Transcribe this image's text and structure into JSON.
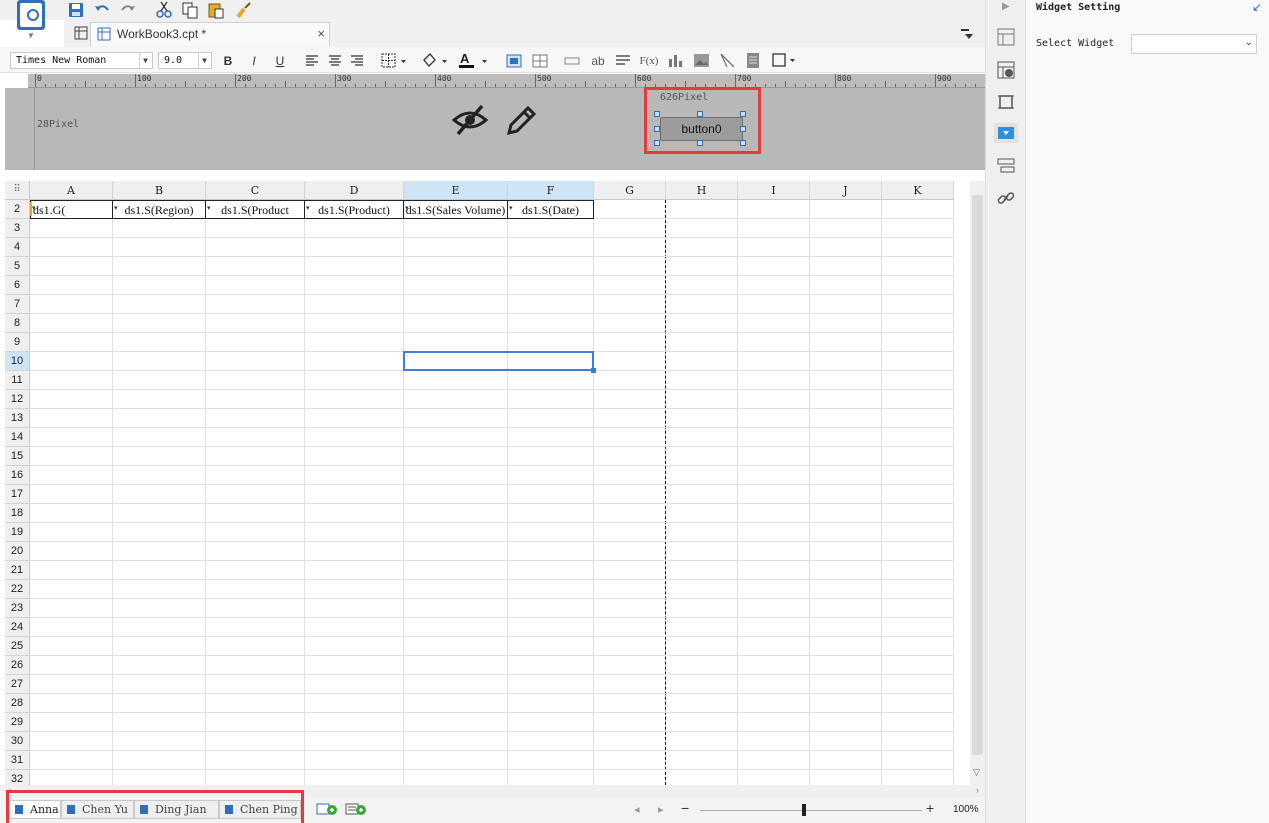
{
  "app": {
    "toolbar_dropdown_arrow": "▾"
  },
  "tab": {
    "label": "WorkBook3.cpt *",
    "close": "×"
  },
  "format_bar": {
    "font_name": "Times New Roman",
    "font_size": "9.0",
    "bold": "B",
    "italic": "I",
    "underline": "U",
    "text_sample": "ab",
    "formula": "F(x)"
  },
  "ruler": {
    "labels": [
      "0",
      "100",
      "200",
      "300",
      "400",
      "500",
      "600",
      "700",
      "800",
      "900"
    ]
  },
  "form": {
    "left_label": "28Pixel",
    "top_label": "626Pixel",
    "button_label": "button0"
  },
  "grid": {
    "columns": [
      "A",
      "B",
      "C",
      "D",
      "E",
      "F",
      "G",
      "H",
      "I",
      "J",
      "K"
    ],
    "highlighted_columns": [
      "E",
      "F"
    ],
    "rows": [
      "2",
      "3",
      "4",
      "5",
      "6",
      "7",
      "8",
      "9",
      "10",
      "11",
      "12",
      "13",
      "14",
      "15",
      "16",
      "17",
      "18",
      "19",
      "20",
      "21",
      "22",
      "23",
      "24",
      "25",
      "26",
      "27",
      "28",
      "29",
      "30",
      "31",
      "32"
    ],
    "highlighted_row": "10",
    "row2_cells": [
      "ds1.G(",
      "ds1.S(Region)",
      "ds1.S(Product",
      "ds1.S(Product)",
      "ds1.S(Sales Volume)",
      "ds1.S(Date)"
    ]
  },
  "sheets": [
    {
      "name": "Anna",
      "active": true
    },
    {
      "name": "Chen Yu",
      "active": false
    },
    {
      "name": "Ding Jian",
      "active": false
    },
    {
      "name": "Chen Ping",
      "active": false
    }
  ],
  "zoom": {
    "minus": "−",
    "plus": "+",
    "value": "100%"
  },
  "right_panel": {
    "title": "Widget Setting",
    "select_label": "Select Widget",
    "select_value": ""
  },
  "colors": {
    "accent": "#2f6fc0",
    "highlight_border": "#e43c3c",
    "selection": "#3a7ddb"
  }
}
